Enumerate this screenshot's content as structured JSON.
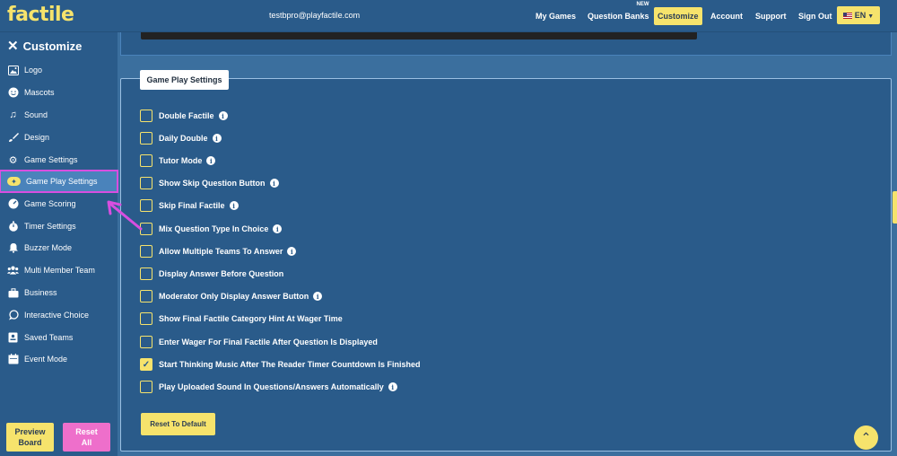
{
  "header": {
    "logo": "factile",
    "email": "testbpro@playfactile.com",
    "nav": [
      {
        "label": "My Games"
      },
      {
        "label": "Question Banks",
        "badge": "NEW"
      },
      {
        "label": "Customize"
      },
      {
        "label": "Account"
      },
      {
        "label": "Support"
      },
      {
        "label": "Sign Out"
      }
    ],
    "language": "EN"
  },
  "sidebar": {
    "title": "Customize",
    "items": [
      {
        "label": "Logo",
        "icon": "image-icon"
      },
      {
        "label": "Mascots",
        "icon": "smiley-icon"
      },
      {
        "label": "Sound",
        "icon": "music-note-icon"
      },
      {
        "label": "Design",
        "icon": "paintbrush-icon"
      },
      {
        "label": "Game Settings",
        "icon": "gear-icon"
      },
      {
        "label": "Game Play Settings",
        "icon": "gamepad-icon"
      },
      {
        "label": "Game Scoring",
        "icon": "speedometer-icon"
      },
      {
        "label": "Timer Settings",
        "icon": "stopwatch-icon"
      },
      {
        "label": "Buzzer Mode",
        "icon": "bell-icon"
      },
      {
        "label": "Multi Member Team",
        "icon": "users-icon"
      },
      {
        "label": "Business",
        "icon": "briefcase-icon"
      },
      {
        "label": "Interactive Choice",
        "icon": "chat-icon"
      },
      {
        "label": "Saved Teams",
        "icon": "id-card-icon"
      },
      {
        "label": "Event Mode",
        "icon": "calendar-icon"
      }
    ],
    "active_item": "Game Play Settings",
    "preview_line1": "Preview",
    "preview_line2": "Board",
    "reset_line1": "Reset",
    "reset_line2": "All"
  },
  "main": {
    "section_title": "Game Play Settings",
    "options": [
      {
        "label": "Double Factile",
        "checked": false,
        "info": true
      },
      {
        "label": "Daily Double",
        "checked": false,
        "info": true
      },
      {
        "label": "Tutor Mode",
        "checked": false,
        "info": true
      },
      {
        "label": "Show Skip Question Button",
        "checked": false,
        "info": true
      },
      {
        "label": "Skip Final Factile",
        "checked": false,
        "info": true
      },
      {
        "label": "Mix Question Type In Choice",
        "checked": false,
        "info": true
      },
      {
        "label": "Allow Multiple Teams To Answer",
        "checked": false,
        "info": true
      },
      {
        "label": "Display Answer Before Question",
        "checked": false,
        "info": false
      },
      {
        "label": "Moderator Only Display Answer Button",
        "checked": false,
        "info": true
      },
      {
        "label": "Show Final Factile Category Hint At Wager Time",
        "checked": false,
        "info": false
      },
      {
        "label": "Enter Wager For Final Factile After Question Is Displayed",
        "checked": false,
        "info": false
      },
      {
        "label": "Start Thinking Music After The Reader Timer Countdown Is Finished",
        "checked": true,
        "info": false
      },
      {
        "label": "Play Uploaded Sound In Questions/Answers Automatically",
        "checked": false,
        "info": true
      }
    ],
    "reset_default_label": "Reset To Default"
  },
  "colors": {
    "accent_yellow": "#f6e36c",
    "panel_blue": "#2a5b8a",
    "highlight_magenta": "#d84ee0",
    "reset_pink": "#ee6fcb"
  }
}
